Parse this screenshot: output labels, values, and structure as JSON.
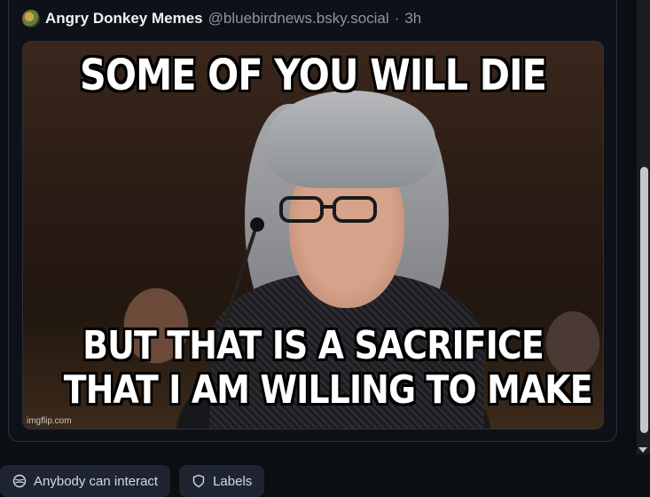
{
  "post": {
    "author_name": "Angry Donkey Memes",
    "handle": "@bluebirdnews.bsky.social",
    "separator": "·",
    "time": "3h",
    "avatar_icon": "donkey-avatar"
  },
  "meme": {
    "top_caption": "SOME OF YOU WILL DIE",
    "bottom_caption_line1": "BUT THAT IS A SACRIFICE",
    "bottom_caption_line2": "THAT I AM WILLING TO MAKE",
    "watermark": "imgflip.com"
  },
  "bottom_bar": {
    "interaction_label": "Anybody can interact",
    "interaction_icon": "globe-icon",
    "labels_label": "Labels",
    "labels_icon": "shield-icon"
  },
  "colors": {
    "background": "#0b0e13",
    "chip_background": "#1e2430",
    "handle_text": "#8a96a8"
  }
}
